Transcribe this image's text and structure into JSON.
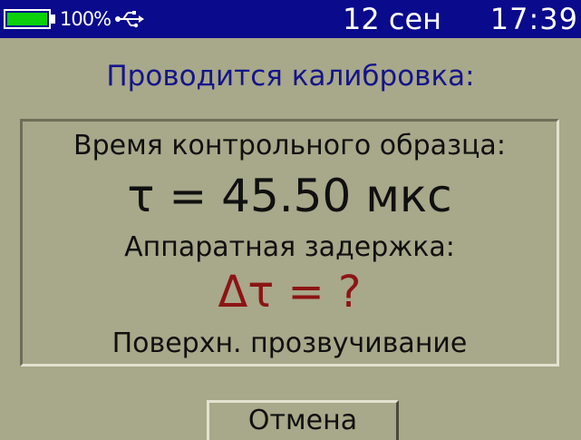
{
  "status_bar": {
    "battery_percent_text": "100%",
    "battery_level": 1.0,
    "usb_icon": "usb-icon",
    "date": "12 сен",
    "time": "17:39"
  },
  "title": "Проводится калибровка:",
  "panel": {
    "reference_time_label": "Время контрольного образца:",
    "tau_value": "τ = 45.50 мкс",
    "hardware_delay_label": "Аппаратная задержка:",
    "delta_tau_value": "Δτ = ?",
    "mode_label": "Поверхн. прозвучивание"
  },
  "cancel_label": "Отмена",
  "colors": {
    "background": "#a8a88a",
    "status_bar": "#0a0a8c",
    "battery_fill": "#0bd10b",
    "title_text": "#14148c",
    "delta_tau_text": "#8c1414"
  }
}
